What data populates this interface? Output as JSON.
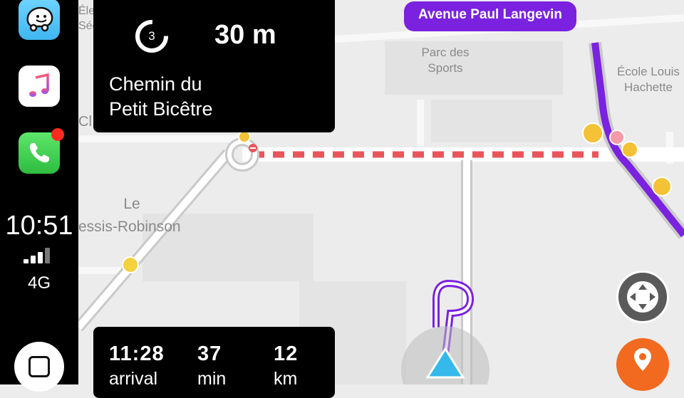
{
  "sidebar": {
    "apps": [
      {
        "name": "Waze",
        "icon": "waze-icon"
      },
      {
        "name": "Music",
        "icon": "music-icon"
      },
      {
        "name": "Phone",
        "icon": "phone-icon",
        "badge": true
      }
    ],
    "time": "10:51",
    "network": "4G",
    "signal_bars": 4
  },
  "map": {
    "labels": {
      "top_left_partial": "Éle\nSéc",
      "parc": "Parc des\nSports",
      "ecole": "École Louis\nHachette",
      "cl": "Cl",
      "le": "Le",
      "plessis": "essis-Robinson"
    }
  },
  "navigation": {
    "current_street": "Avenue Paul Langevin",
    "turn": {
      "roundabout_exit": "3",
      "distance": "30 m",
      "street_line1": "Chemin du",
      "street_line2": "Petit Bicêtre"
    },
    "eta": {
      "arrival_value": "11:28",
      "arrival_label": "arrival",
      "duration_value": "37",
      "duration_label": "min",
      "distance_value": "12",
      "distance_label": "km"
    }
  },
  "colors": {
    "route": "#7b21e0",
    "map_bg": "#ececec",
    "road": "#ffffff",
    "closure": "#e9555a",
    "report": "#f26a1f",
    "vehicle": "#35b8ea"
  }
}
